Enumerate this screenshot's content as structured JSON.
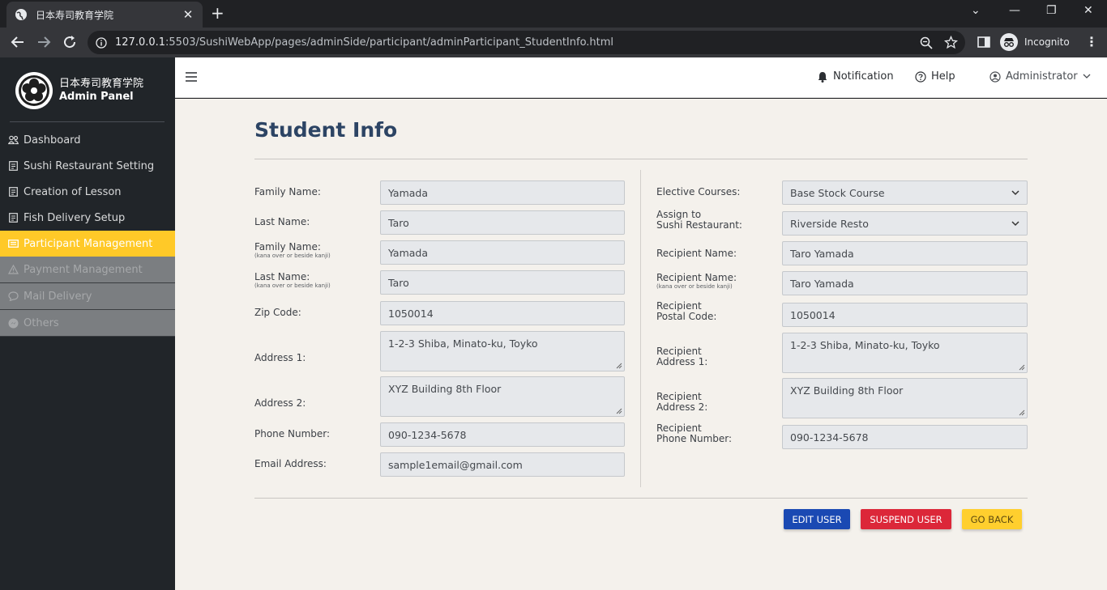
{
  "browser": {
    "tab_title": "日本寿司教育学院",
    "url_host": "127.0.0.1",
    "url_rest": ":5503/SushiWebApp/pages/adminSide/participant/adminParticipant_StudentInfo.html",
    "incognito_label": "Incognito"
  },
  "sidebar": {
    "brand_name": "日本寿司教育学院",
    "brand_sub": "Admin Panel",
    "items": [
      {
        "label": "Dashboard"
      },
      {
        "label": "Sushi Restaurant Setting"
      },
      {
        "label": "Creation of Lesson"
      },
      {
        "label": "Fish Delivery Setup"
      },
      {
        "label": "Participant Management"
      },
      {
        "label": "Payment Management"
      },
      {
        "label": "Mail Delivery"
      },
      {
        "label": "Others"
      }
    ]
  },
  "topnav": {
    "notification": "Notification",
    "help": "Help",
    "user": "Administrator"
  },
  "page": {
    "title": "Student Info"
  },
  "left": {
    "family_name_label": "Family Name:",
    "family_name": "Yamada",
    "last_name_label": "Last Name:",
    "last_name": "Taro",
    "family_kana_label": "Family Name:",
    "kana_note": "(kana over or beside kanji)",
    "family_kana": "Yamada",
    "last_kana_label": "Last Name:",
    "last_kana": "Taro",
    "zip_label": "Zip Code:",
    "zip": "1050014",
    "addr1_label": "Address 1:",
    "addr1": "1-2-3 Shiba, Minato-ku, Toyko",
    "addr2_label": "Address 2:",
    "addr2": "XYZ Building 8th Floor",
    "phone_label": "Phone Number:",
    "phone": "090-1234-5678",
    "email_label": "Email Address:",
    "email": "sample1email@gmail.com"
  },
  "right": {
    "elective_label": "Elective Courses:",
    "elective": "Base Stock Course",
    "assign_label_1": "Assign to",
    "assign_label_2": "Sushi Restaurant:",
    "assign": "Riverside Resto",
    "recipient_name_label": "Recipient Name:",
    "recipient_name": "Taro Yamada",
    "recipient_kana_label": "Recipient Name:",
    "kana_note": "(kana over or beside kanji)",
    "recipient_kana": "Taro Yamada",
    "postal_label_1": "Recipient",
    "postal_label_2": "Postal Code:",
    "postal": "1050014",
    "raddr1_label_1": "Recipient",
    "raddr1_label_2": "Address 1:",
    "raddr1": "1-2-3 Shiba, Minato-ku, Toyko",
    "raddr2_label_1": "Recipient",
    "raddr2_label_2": "Address 2:",
    "raddr2": "XYZ Building 8th Floor",
    "rphone_label_1": "Recipient",
    "rphone_label_2": "Phone Number:",
    "rphone": "090-1234-5678"
  },
  "actions": {
    "edit": "EDIT USER",
    "suspend": "SUSPEND USER",
    "back": "GO BACK"
  },
  "colors": {
    "sidebar_bg": "#212529",
    "active_item": "#ffc928",
    "title": "#2c4464",
    "edit": "#1a49b3",
    "suspend": "#dc2739",
    "back": "#ffcf2e"
  }
}
